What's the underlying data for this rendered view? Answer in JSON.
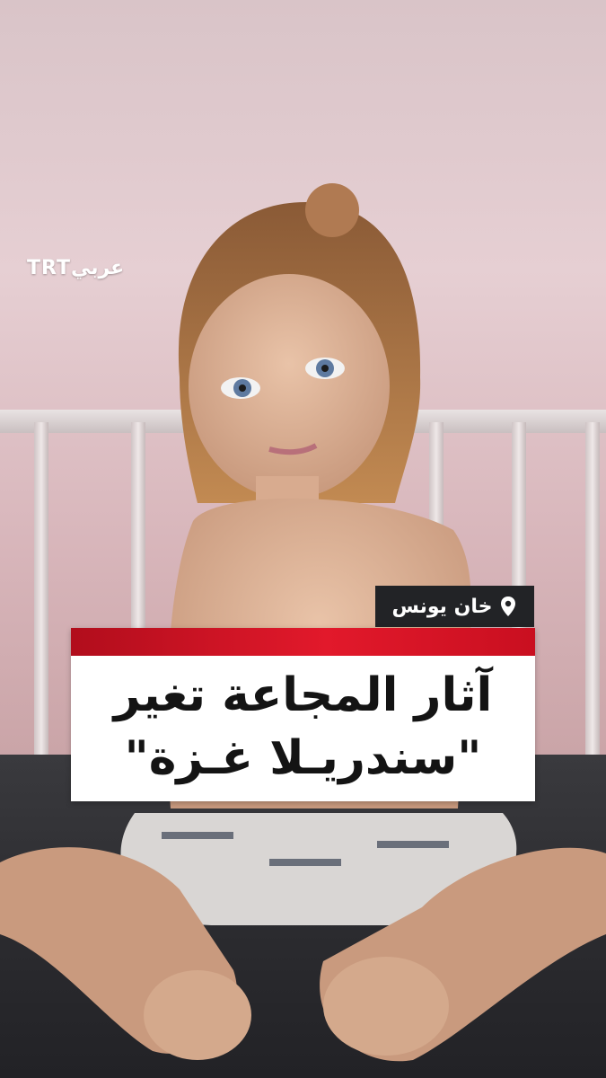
{
  "logo": {
    "text": "TRTعربي"
  },
  "location": {
    "label": "خان يونس",
    "icon": "map-pin-icon"
  },
  "headline": {
    "line1": "آثار المجاعة تغير",
    "line2": "\"سندريـلا غـزة\""
  },
  "colors": {
    "accent_red": "#e2192b",
    "location_bg": "#222326",
    "headline_bg": "#ffffff",
    "headline_text": "#141414"
  },
  "photo": {
    "subject": "photograph"
  }
}
